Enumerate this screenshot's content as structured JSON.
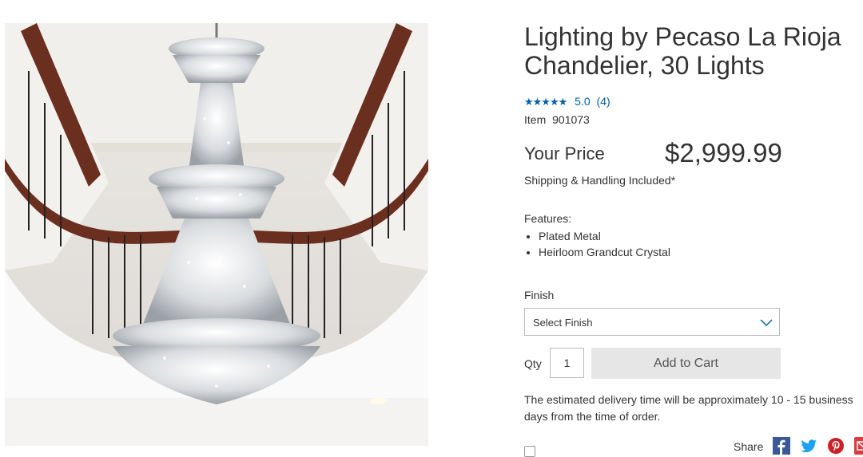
{
  "product": {
    "title": "Lighting by Pecaso La Rioja Chandelier, 30 Lights",
    "rating": {
      "stars": "★★★★★",
      "value": "5.0",
      "count": "(4)",
      "score": 5.0
    },
    "item_label": "Item",
    "item_number": "901073",
    "price_label": "Your Price",
    "price": "$2,999.99",
    "shipping": "Shipping & Handling Included*",
    "features_label": "Features:",
    "features": [
      "Plated Metal",
      "Heirloom Grandcut Crystal"
    ],
    "finish_label": "Finish",
    "finish_select": "Select Finish",
    "qty_label": "Qty",
    "qty_value": "1",
    "add_to_cart": "Add to Cart",
    "delivery": "The estimated delivery time will be approximately 10 - 15 business days from the time of order.",
    "share_label": "Share"
  },
  "icons": {
    "facebook": {
      "name": "facebook-icon",
      "color": "#3b5998"
    },
    "twitter": {
      "name": "twitter-icon",
      "color": "#1da1f2"
    },
    "pinterest": {
      "name": "pinterest-icon",
      "color": "#cb2027"
    },
    "email": {
      "name": "email-icon",
      "color": "#e03a3e"
    }
  },
  "colors": {
    "link": "#0060a9",
    "cart_button_bg": "#e6e6e6"
  }
}
